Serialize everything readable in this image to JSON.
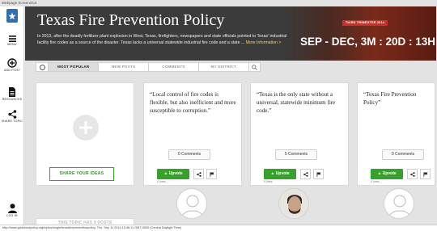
{
  "window": {
    "title": "Webpage Screenshot"
  },
  "sidebar": {
    "items": [
      {
        "label": "MENU"
      },
      {
        "label": "ADD POST"
      },
      {
        "label": "RESOURCES"
      },
      {
        "label": "SHARE TOPIC"
      },
      {
        "label": "LOG IN"
      }
    ]
  },
  "hero": {
    "title": "Texas Fire Prevention Policy",
    "description": "In 2013, after the deadly fertilizer plant explosion in West, Texas, firefighters, newspapers and state officials pointed to Texas' industrial facility fire codes as a source of the disaster. Texas lacks a universal statewide industrial fire code and a state ...",
    "more_link": "More Information >",
    "badge": "THIRD TRIMESTER 2014",
    "countdown": "SEP - DEC, 3M : 20D : 13H"
  },
  "tabs": [
    {
      "label": "MOST POPULAR",
      "active": true
    },
    {
      "label": "NEW POSTS",
      "active": false
    },
    {
      "label": "COMMENTS",
      "active": false
    },
    {
      "label": "MY DISTRICT",
      "active": false
    }
  ],
  "add_card": {
    "button": "SHARE YOUR IDEAS"
  },
  "posts": [
    {
      "quote": "“Local control of fire codes is flexible, but also inefficient and more susceptible to corruption.”",
      "comments": "0 Comments",
      "upvote": "Upvote",
      "votes": "0 Votes"
    },
    {
      "quote": "“Texas is the only state without a universal, statewide minimum fire code.”",
      "comments": "5 Comments",
      "upvote": "Upvote",
      "votes": "5 Votes"
    },
    {
      "quote": "“Texas Fire Prevention Policy”",
      "comments": "0 Comments",
      "upvote": "Upvote",
      "votes": "0 Votes"
    }
  ],
  "topic_posts": "THIS TOPIC HAS 9 POSTS",
  "status_bar": "http://www.gridshoutpolicy.org/topics/single/texasfirepreventionpolicy, Thu, Sep 11 2014 10:46:11 GMT-0500 (Central Daylight Time)",
  "colors": {
    "accent_green": "#39a02e",
    "hero_bg": "#3b3b3b",
    "badge_red": "#c9302c",
    "logo_blue": "#2f6db5"
  }
}
